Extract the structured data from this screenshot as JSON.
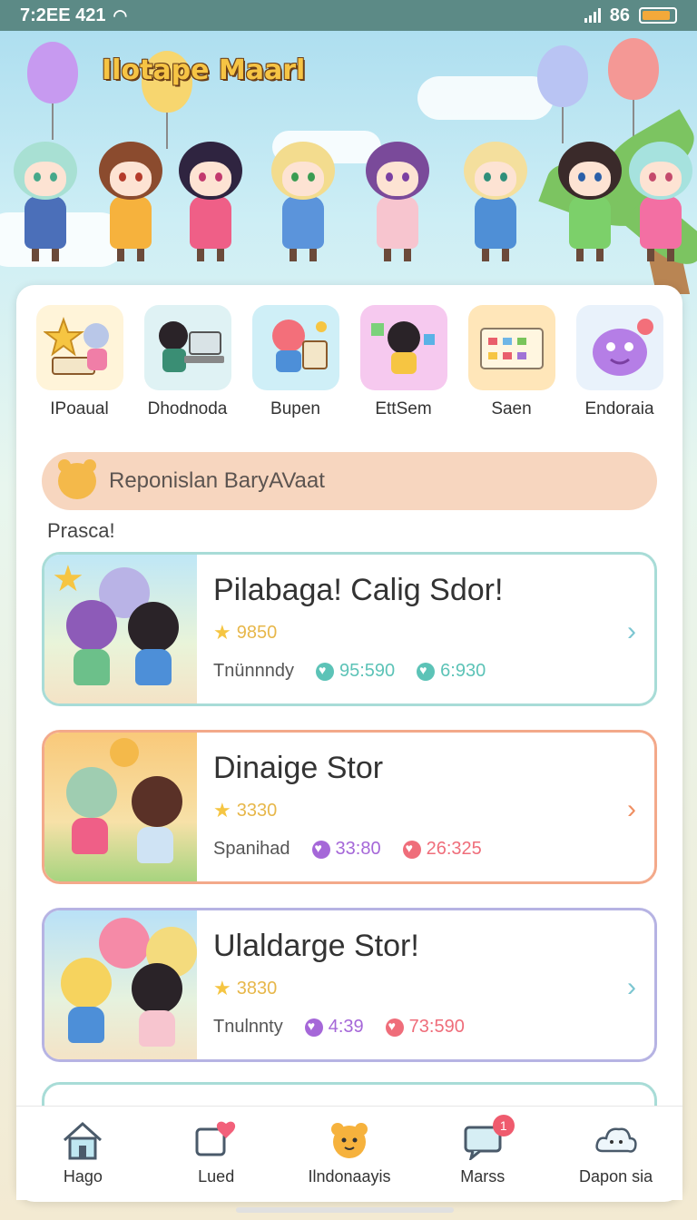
{
  "status_bar": {
    "time": "7:2EE 421",
    "signal_text": "86"
  },
  "app": {
    "title": "Ilotape Maarl"
  },
  "categories": [
    {
      "label": "IPoaual",
      "icon": "storybook-icon",
      "color": "#fff4d9"
    },
    {
      "label": "Dhodnoda",
      "icon": "laptop-icon",
      "color": "#dff2f4"
    },
    {
      "label": "Bupen",
      "icon": "drawing-icon",
      "color": "#cfeff7"
    },
    {
      "label": "EttSem",
      "icon": "gallery-icon",
      "color": "#f6c9ef"
    },
    {
      "label": "Saen",
      "icon": "board-icon",
      "color": "#ffe6b9"
    },
    {
      "label": "Endoraia",
      "icon": "monster-icon",
      "color": "#e9f2fb"
    }
  ],
  "promo": {
    "text": "Reponislan BaryAVaat"
  },
  "section": {
    "label": "Prasca!"
  },
  "stories": [
    {
      "title": "Pilabaga! Calig Sdor!",
      "rating": "9850",
      "author": "Tnünnndy",
      "stat1": "95:590",
      "stat2": "6:930",
      "border": "#a8dcd7",
      "stat1_color": "#5cc3b7",
      "stat2_color": "#5cc3b7",
      "chev_color": "#7cc6d1"
    },
    {
      "title": "Dinaige Stor",
      "rating": "3330",
      "author": "Spanihad",
      "stat1": "33:80",
      "stat2": "26:325",
      "border": "#f3a98a",
      "stat1_color": "#a567d8",
      "stat2_color": "#ef6d7a",
      "chev_color": "#ef8f63"
    },
    {
      "title": "Ulaldarge Stor!",
      "rating": "3830",
      "author": "Tnulnnty",
      "stat1": "4:39",
      "stat2": "73:590",
      "border": "#b6b3e3",
      "stat1_color": "#a567d8",
      "stat2_color": "#ef6d7a",
      "chev_color": "#7cc6d1"
    }
  ],
  "nav": [
    {
      "label": "Hago",
      "icon": "home-icon"
    },
    {
      "label": "Lued",
      "icon": "heart-chat-icon"
    },
    {
      "label": "Ilndonaayis",
      "icon": "bear-icon"
    },
    {
      "label": "Marss",
      "icon": "message-icon",
      "badge": "1"
    },
    {
      "label": "Dapon sia",
      "icon": "cloud-icon"
    }
  ]
}
